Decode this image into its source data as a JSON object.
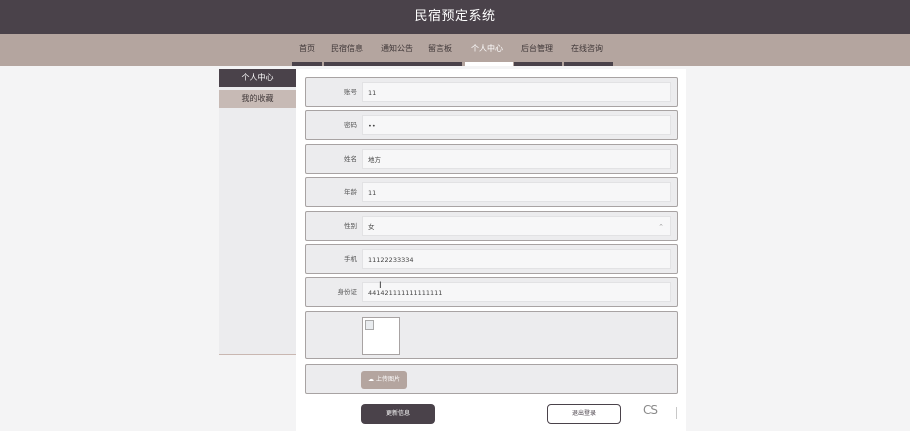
{
  "app": {
    "title": "民宿预定系统"
  },
  "nav": {
    "items": [
      {
        "label": "首页",
        "active": false
      },
      {
        "label": "民宿信息",
        "active": false
      },
      {
        "label": "通知公告",
        "active": false
      },
      {
        "label": "留言板",
        "active": false
      },
      {
        "label": "个人中心",
        "active": true
      },
      {
        "label": "后台管理",
        "active": false
      },
      {
        "label": "在线咨询",
        "active": false
      }
    ]
  },
  "sidebar": {
    "items": [
      {
        "label": "个人中心",
        "active": true
      },
      {
        "label": "我的收藏",
        "active": false
      }
    ]
  },
  "form": {
    "fields": [
      {
        "label": "账号",
        "value": "11"
      },
      {
        "label": "密码",
        "value": "••"
      },
      {
        "label": "姓名",
        "value": "地方"
      },
      {
        "label": "年龄",
        "value": "11"
      },
      {
        "label": "性别",
        "value": "女"
      },
      {
        "label": "手机",
        "value": "11122233334"
      },
      {
        "label": "身份证",
        "value": "441421111111111111"
      }
    ],
    "upload_label": "上传图片",
    "update_label": "更新信息",
    "logout_label": "退出登录"
  },
  "overlay": {
    "watermark": "CSDN"
  },
  "colors": {
    "header": "#4a424a",
    "nav": "#b4a59f",
    "sidebar_selected": "#c7bab5",
    "panel": "#ececee"
  },
  "icons": {
    "upload": "cloud-upload-icon",
    "image": "broken-image-icon",
    "select": "chevron-up-icon"
  }
}
